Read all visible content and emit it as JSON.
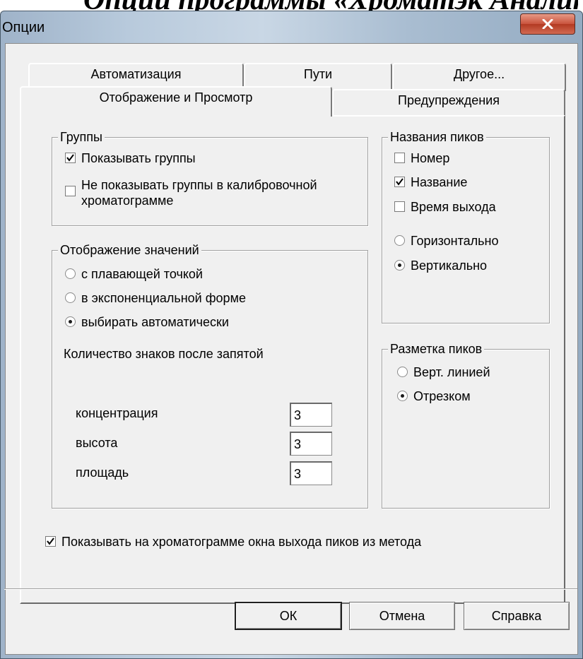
{
  "doc_heading": "Опции программы «Хроматэк Аналитик»",
  "window": {
    "title": "Опции",
    "close_icon": "close-icon"
  },
  "tabs": {
    "back_row": [
      "Автоматизация",
      "Пути",
      "Другое..."
    ],
    "front_row": [
      "Отображение и Просмотр",
      "Предупреждения"
    ],
    "active": "Отображение и Просмотр"
  },
  "groups": {
    "title": "Группы",
    "items": [
      {
        "label": "Показывать группы",
        "checked": true
      },
      {
        "label": "Не показывать группы в калибровочной хроматограмме",
        "checked": false
      }
    ]
  },
  "value_display": {
    "title": "Отображение значений",
    "options": [
      {
        "label": "с плавающей точкой",
        "selected": false
      },
      {
        "label": "в экспоненциальной форме",
        "selected": false
      },
      {
        "label": "выбирать автоматически",
        "selected": true
      }
    ],
    "decimals_label": "Количество знаков после запятой",
    "fields": [
      {
        "label": "концентрация",
        "value": "3"
      },
      {
        "label": "высота",
        "value": "3"
      },
      {
        "label": "площадь",
        "value": "3"
      }
    ]
  },
  "peak_names": {
    "title": "Названия пиков",
    "checks": [
      {
        "label": "Номер",
        "checked": false
      },
      {
        "label": "Название",
        "checked": true
      },
      {
        "label": "Время выхода",
        "checked": false
      }
    ],
    "orientation": [
      {
        "label": "Горизонтально",
        "selected": false
      },
      {
        "label": "Вертикально",
        "selected": true
      }
    ]
  },
  "peak_marking": {
    "title": "Разметка пиков",
    "options": [
      {
        "label": "Верт. линией",
        "selected": false
      },
      {
        "label": "Отрезком",
        "selected": true
      }
    ]
  },
  "show_windows": {
    "label": "Показывать на хроматограмме окна выхода пиков из метода",
    "checked": true
  },
  "buttons": {
    "ok": "ОК",
    "cancel": "Отмена",
    "help": "Справка"
  },
  "colors": {
    "dialog_bg": "#f0f0f0",
    "close_button": "#c9543d",
    "title_bar": "#b8cadc"
  }
}
